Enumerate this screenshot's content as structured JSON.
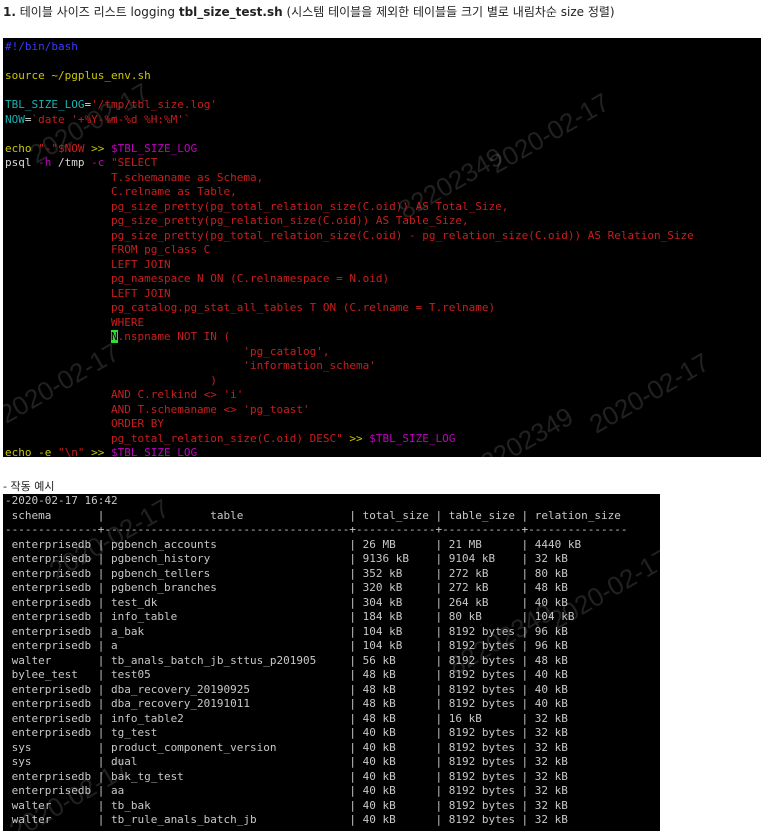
{
  "heading": {
    "number": "1.",
    "prefix": "테이블 사이즈 리스트 logging ",
    "script_name": "tbl_size_test.sh",
    "suffix": " (시스템 테이블을 제외한 테이블들 크기 별로 내림차순 size 정렬)"
  },
  "script": {
    "shebang": "#!/bin/bash",
    "source_line": "source ~/pgplus_env.sh",
    "log_var": "TBL_SIZE_LOG",
    "log_value": "'/tmp/tbl_size.log'",
    "now_var": "NOW",
    "now_cmd": "`date '+%Y-%m-%d %H:%M'`",
    "echo_cmd": "echo",
    "echo_str": "\"-\"$NOW",
    "redir": ">>",
    "log_ref": "$TBL_SIZE_LOG",
    "psql_cmd": "psql",
    "psql_flag_h": "-h",
    "psql_host": "/tmp",
    "psql_flag_c": "-c",
    "sql_open": "\"SELECT",
    "sql_lines": [
      "T.schemaname as Schema,",
      "C.relname as Table,",
      "pg_size_pretty(pg_total_relation_size(C.oid)) AS Total_Size,",
      "pg_size_pretty(pg_relation_size(C.oid)) AS Table_Size,",
      "pg_size_pretty(pg_total_relation_size(C.oid) - pg_relation_size(C.oid)) AS Relation_Size",
      "FROM pg_class C",
      "LEFT JOIN",
      "pg_namespace N ON (C.relnamespace = N.oid)",
      "LEFT JOIN",
      "pg_catalog.pg_stat_all_tables T ON (C.relname = T.relname)",
      "WHERE"
    ],
    "cursor_char": "N",
    "where_rest": ".nspname NOT IN (",
    "in_list": [
      "'pg_catalog',",
      "'information_schema'"
    ],
    "close_paren": ")",
    "and1": "AND C.relkind <> 'i'",
    "and2": "AND T.schemaname <> 'pg_toast'",
    "order_by": "ORDER BY",
    "order_expr": "pg_total_relation_size(C.oid) DESC\"",
    "echo_e": "echo -e",
    "newline_str": "\"\\n\""
  },
  "example_label": "- 작동 예시",
  "output": {
    "timestamp": "-2020-02-17 16:42",
    "header": " schema       |                table                | total_size | table_size | relation_size",
    "separator": "--------------+-------------------------------------+------------+------------+---------------",
    "columns": [
      "schema",
      "table",
      "total_size",
      "table_size",
      "relation_size"
    ],
    "rows": [
      [
        "enterprisedb",
        "pgbench_accounts",
        "26 MB",
        "21 MB",
        "4440 kB"
      ],
      [
        "enterprisedb",
        "pgbench_history",
        "9136 kB",
        "9104 kB",
        "32 kB"
      ],
      [
        "enterprisedb",
        "pgbench_tellers",
        "352 kB",
        "272 kB",
        "80 kB"
      ],
      [
        "enterprisedb",
        "pgbench_branches",
        "320 kB",
        "272 kB",
        "48 kB"
      ],
      [
        "enterprisedb",
        "test_dk",
        "304 kB",
        "264 kB",
        "40 kB"
      ],
      [
        "enterprisedb",
        "info_table",
        "184 kB",
        "80 kB",
        "104 kB"
      ],
      [
        "enterprisedb",
        "a_bak",
        "104 kB",
        "8192 bytes",
        "96 kB"
      ],
      [
        "enterprisedb",
        "a",
        "104 kB",
        "8192 bytes",
        "96 kB"
      ],
      [
        "walter",
        "tb_anals_batch_jb_sttus_p201905",
        "56 kB",
        "8192 bytes",
        "48 kB"
      ],
      [
        "bylee_test",
        "test05",
        "48 kB",
        "8192 bytes",
        "40 kB"
      ],
      [
        "enterprisedb",
        "dba_recovery_20190925",
        "48 kB",
        "8192 bytes",
        "40 kB"
      ],
      [
        "enterprisedb",
        "dba_recovery_20191011",
        "48 kB",
        "8192 bytes",
        "40 kB"
      ],
      [
        "enterprisedb",
        "info_table2",
        "48 kB",
        "16 kB",
        "32 kB"
      ],
      [
        "enterprisedb",
        "tg_test",
        "40 kB",
        "8192 bytes",
        "32 kB"
      ],
      [
        "sys",
        "product_component_version",
        "40 kB",
        "8192 bytes",
        "32 kB"
      ],
      [
        "sys",
        "dual",
        "40 kB",
        "8192 bytes",
        "32 kB"
      ],
      [
        "enterprisedb",
        "bak_tg_test",
        "40 kB",
        "8192 bytes",
        "32 kB"
      ],
      [
        "enterprisedb",
        "aa",
        "40 kB",
        "8192 bytes",
        "32 kB"
      ],
      [
        "walter",
        "tb_bak",
        "40 kB",
        "8192 bytes",
        "32 kB"
      ],
      [
        "walter",
        "tb_rule_anals_batch_jb",
        "40 kB",
        "8192 bytes",
        "32 kB"
      ]
    ]
  },
  "watermarks": [
    "2020-02-17",
    "82202349",
    "2020-02-17",
    "2020-02-17",
    "82202349",
    "2020-02-17"
  ]
}
